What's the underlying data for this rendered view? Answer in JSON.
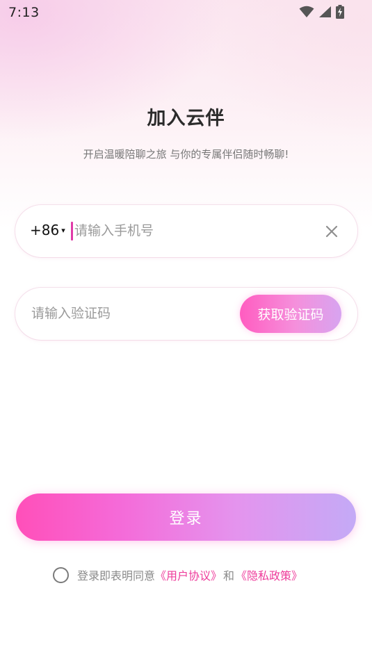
{
  "status_bar": {
    "time": "7:13",
    "icons": [
      "wifi-icon",
      "cellular-signal-icon",
      "battery-charging-icon"
    ]
  },
  "header": {
    "title": "加入云伴",
    "subtitle": "开启温暖陪聊之旅 与你的专属伴侣随时畅聊!"
  },
  "phone_field": {
    "country_code": "+86",
    "caret": "▾",
    "value": "",
    "placeholder": "请输入手机号"
  },
  "code_field": {
    "value": "",
    "placeholder": "请输入验证码",
    "get_code_label": "获取验证码"
  },
  "login_button": {
    "label": "登录"
  },
  "agreement": {
    "checked": false,
    "prefix": "登录即表明同意",
    "user_agreement": "《用户协议》",
    "and": "和",
    "privacy_policy": "《隐私政策》"
  },
  "colors": {
    "accent_pink": "#ee3c9b",
    "button_gradient_start": "#ff4fb9",
    "button_gradient_end": "#c4aaf6"
  }
}
